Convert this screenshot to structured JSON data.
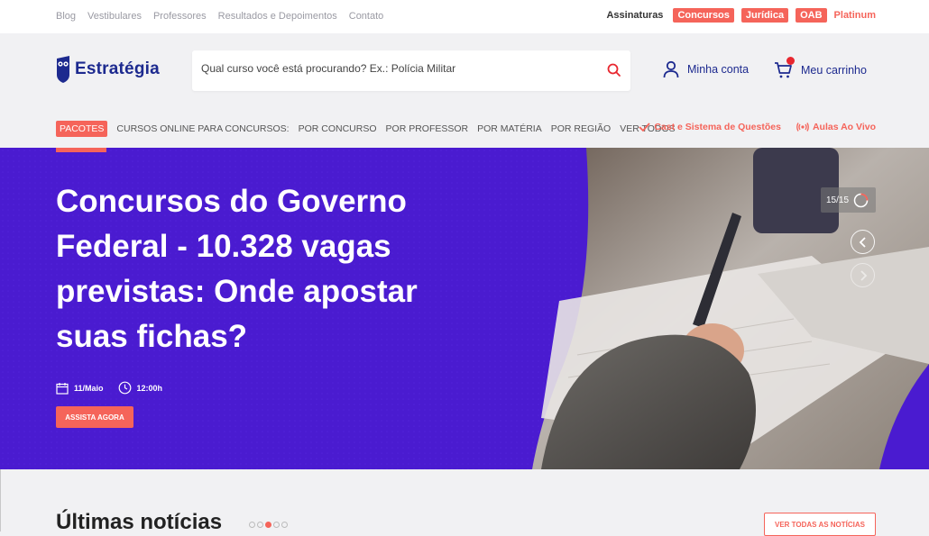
{
  "topbar": {
    "links": [
      "Blog",
      "Vestibulares",
      "Professores",
      "Resultados e Depoimentos",
      "Contato"
    ],
    "subscriptions_label": "Assinaturas",
    "badges": [
      "Concursos",
      "Jurídica",
      "OAB"
    ],
    "platinum": "Platinum"
  },
  "header": {
    "logo_text": "Estratégia",
    "search_placeholder": "Qual curso você está procurando? Ex.: Polícia Militar",
    "account_label": "Minha conta",
    "cart_label": "Meu carrinho"
  },
  "subnav": {
    "packages": "PACOTES",
    "online_label": "CURSOS ONLINE PARA CONCURSOS:",
    "items": [
      "POR CONCURSO",
      "POR PROFESSOR",
      "POR MATÉRIA",
      "POR REGIÃO",
      "VER TODOS"
    ],
    "cast": "Cast e Sistema de Questões",
    "live": "Aulas Ao Vivo"
  },
  "hero": {
    "title": "Concursos do Governo Federal - 10.328 vagas previstas: Onde apostar suas fichas?",
    "date": "11/Maio",
    "time": "12:00h",
    "cta": "ASSISTA AGORA",
    "counter": "15/15"
  },
  "news": {
    "title": "Últimas notícias",
    "dots_count": 5,
    "active_dot": 2,
    "all_button": "VER TODAS AS NOTÍCIAS"
  },
  "colors": {
    "accent": "#f5645a",
    "brand": "#1d2a8f",
    "hero_bg": "#4a1bd0"
  }
}
